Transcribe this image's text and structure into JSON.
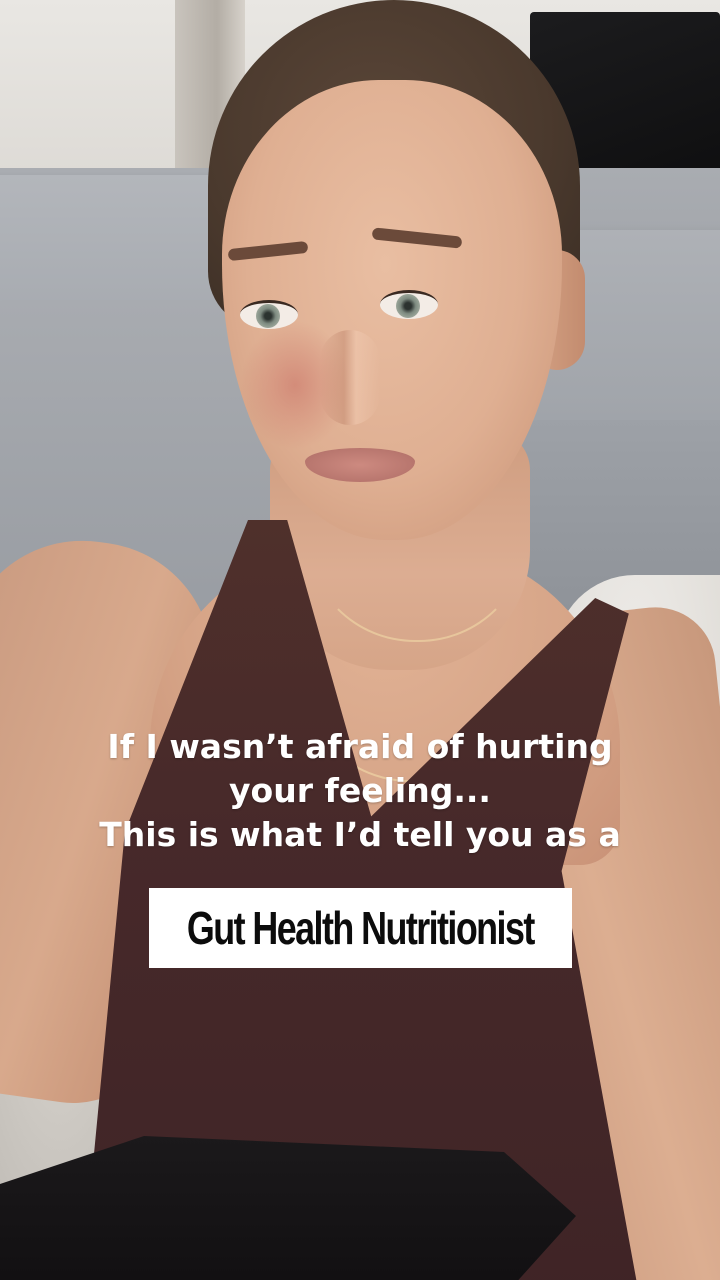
{
  "caption": {
    "line1": "If I wasn’t afraid of hurting",
    "line2": "your feeling...",
    "line3": "This is what I’d tell you as a"
  },
  "label": {
    "text": "Gut Health Nutritionist"
  },
  "colors": {
    "label_background": "#ffffff",
    "label_text": "#0c0c0c",
    "caption_text": "#ffffff"
  }
}
